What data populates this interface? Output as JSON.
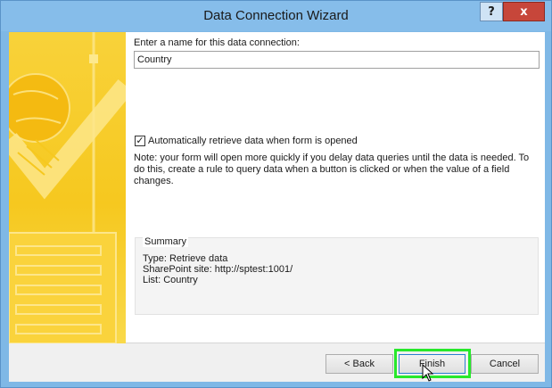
{
  "window": {
    "title": "Data Connection Wizard",
    "help_glyph": "?",
    "close_glyph": "x"
  },
  "form": {
    "name_label": "Enter a name for this data connection:",
    "name_value": "Country",
    "checkbox_label": "Automatically retrieve data when form is opened",
    "checkbox_checked": true,
    "note": "Note: your form will open more quickly if you delay data queries until the data is needed. To do this, create a rule to query data when a button is clicked or when the value of a field changes."
  },
  "summary": {
    "title": "Summary",
    "type_line": "Type: Retrieve data",
    "site_line": "SharePoint site: http://sptest:1001/",
    "list_line": "List: Country"
  },
  "buttons": {
    "back": "< Back",
    "finish": "Finish",
    "cancel": "Cancel"
  },
  "colors": {
    "highlight": "#27e82b",
    "banner": "#f6c81f",
    "titlebar": "#86bdea"
  },
  "icons": {
    "help": "question-icon",
    "close": "close-icon",
    "cursor": "mouse-pointer-icon"
  }
}
